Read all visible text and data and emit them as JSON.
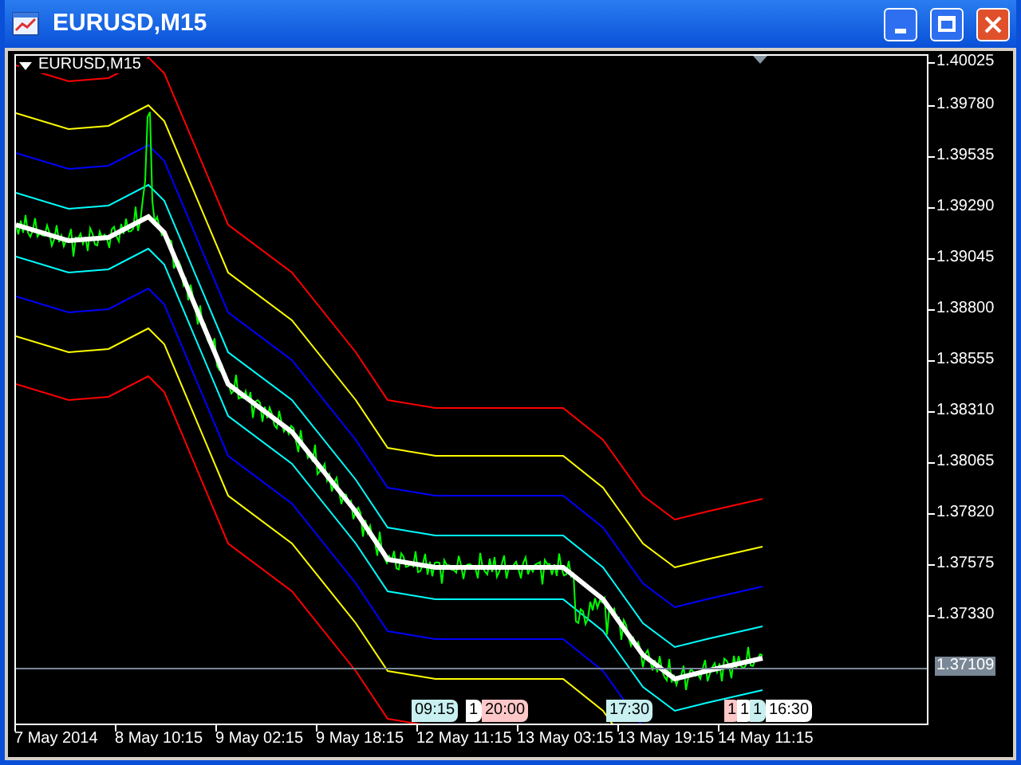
{
  "window": {
    "title": "EURUSD,M15"
  },
  "chart": {
    "label": "EURUSD,M15",
    "price_ticks": [
      "1.40025",
      "1.39780",
      "1.39535",
      "1.39290",
      "1.39045",
      "1.38800",
      "1.38555",
      "1.38310",
      "1.38065",
      "1.37820",
      "1.37575",
      "1.37330"
    ],
    "current_price": "1.37109",
    "time_ticks": [
      "7 May 2014",
      "8 May 10:15",
      "9 May 02:15",
      "9 May 18:15",
      "12 May 11:15",
      "13 May 03:15",
      "13 May 19:15",
      "14 May 11:15"
    ],
    "time_tags": [
      {
        "text": "09:15",
        "color": "#c8f0f0"
      },
      {
        "text": "1",
        "color": "#ffffff"
      },
      {
        "text": "20:00",
        "color": "#ffc8c8"
      },
      {
        "text": "17:30",
        "color": "#c8f0f0"
      },
      {
        "text": "1",
        "color": "#ffc8c8"
      },
      {
        "text": "1",
        "color": "#ffffff"
      },
      {
        "text": "1",
        "color": "#c8f0f0"
      },
      {
        "text": "16:30",
        "color": "#ffffff"
      }
    ]
  }
}
